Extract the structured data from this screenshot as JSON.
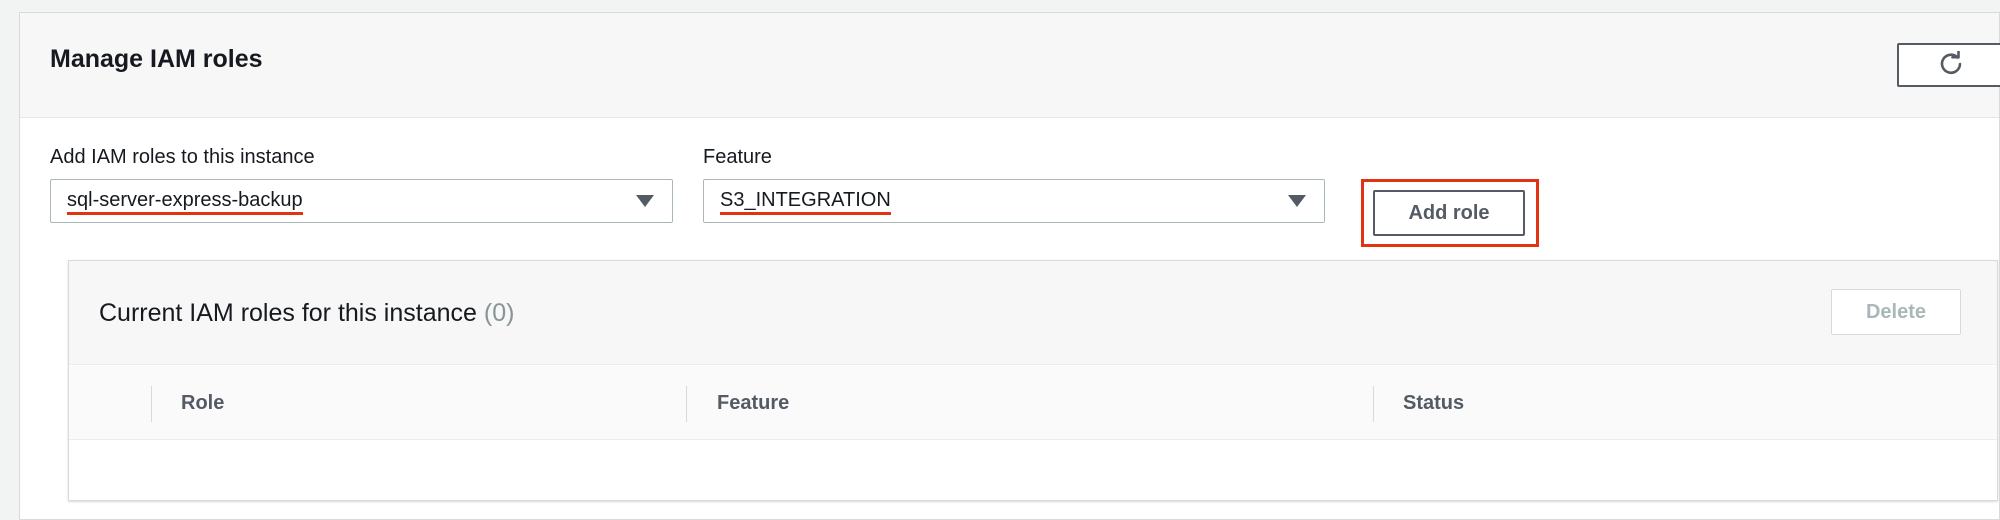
{
  "panel": {
    "title": "Manage IAM roles",
    "refresh_icon": "refresh-icon"
  },
  "form": {
    "role_label": "Add IAM roles to this instance",
    "role_value": "sql-server-express-backup",
    "feature_label": "Feature",
    "feature_value": "S3_INTEGRATION",
    "add_role_label": "Add role"
  },
  "current_roles": {
    "title": "Current IAM roles for this instance",
    "count": "(0)",
    "delete_label": "Delete",
    "columns": [
      "Role",
      "Feature",
      "Status"
    ],
    "rows": []
  },
  "colors": {
    "annotation_red": "#df3312",
    "button_border": "#545b64",
    "disabled_text": "#aab7b8"
  }
}
